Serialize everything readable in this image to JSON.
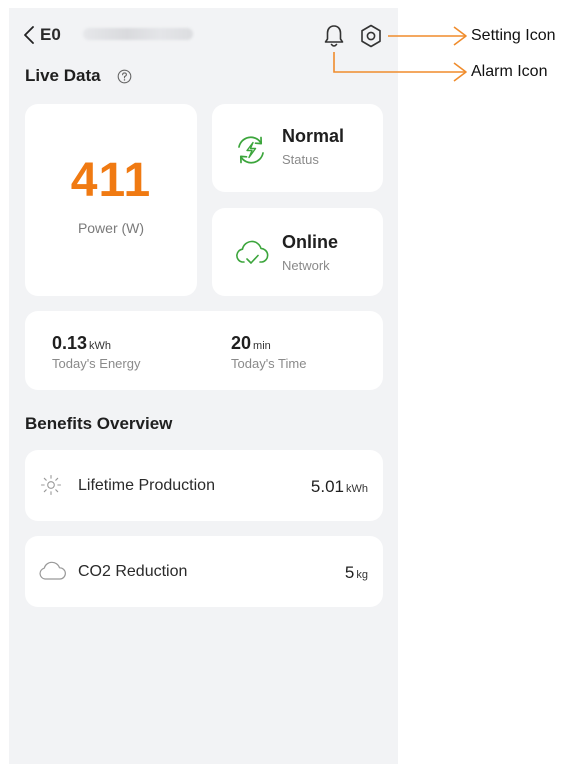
{
  "header": {
    "device_name": "E0"
  },
  "live_data": {
    "title": "Live Data",
    "power": {
      "value": "411",
      "label": "Power (W)"
    },
    "status": {
      "value": "Normal",
      "label": "Status"
    },
    "network": {
      "value": "Online",
      "label": "Network"
    },
    "energy": {
      "value": "0.13",
      "unit": "kWh",
      "label": "Today's Energy"
    },
    "time": {
      "value": "20",
      "unit": "min",
      "label": "Today's Time"
    }
  },
  "benefits": {
    "title": "Benefits Overview",
    "lifetime": {
      "label": "Lifetime Production",
      "value": "5.01",
      "unit": "kWh"
    },
    "co2": {
      "label": "CO2 Reduction",
      "value": "5",
      "unit": "kg"
    }
  },
  "annotations": {
    "setting": "Setting Icon",
    "alarm": "Alarm Icon",
    "color": "#f08c2c"
  },
  "colors": {
    "accent_orange": "#f07a12",
    "icon_green": "#3ca53c",
    "background": "#f2f3f5"
  }
}
